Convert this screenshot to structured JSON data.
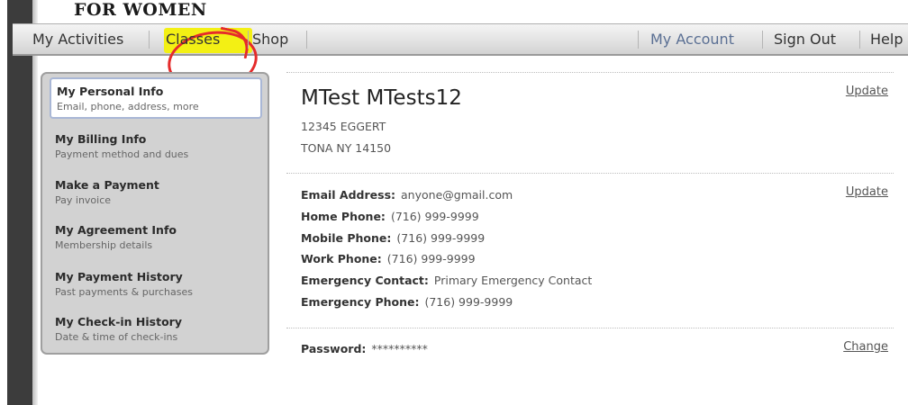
{
  "brand": "FOR WOMEN",
  "nav": {
    "left": [
      "My Activities",
      "Classes",
      "Shop"
    ],
    "right": [
      "My Account",
      "Sign Out",
      "Help"
    ]
  },
  "sidebar": {
    "items": [
      {
        "title": "My Personal Info",
        "subtitle": "Email, phone, address, more"
      },
      {
        "title": "My Billing Info",
        "subtitle": "Payment method and dues"
      },
      {
        "title": "Make a Payment",
        "subtitle": "Pay invoice"
      },
      {
        "title": "My Agreement Info",
        "subtitle": "Membership details"
      },
      {
        "title": "My Payment History",
        "subtitle": "Past payments & purchases"
      },
      {
        "title": "My Check-in History",
        "subtitle": "Date & time of check-ins"
      }
    ]
  },
  "profile": {
    "name": "MTest MTests12",
    "address_line1": "12345 EGGERT",
    "address_line2": "TONA NY 14150",
    "update_label": "Update"
  },
  "contact": {
    "update_label": "Update",
    "email_label": "Email Address:",
    "email": "anyone@gmail.com",
    "home_label": "Home Phone:",
    "home": "(716) 999-9999",
    "mobile_label": "Mobile Phone:",
    "mobile": "(716) 999-9999",
    "work_label": "Work Phone:",
    "work": "(716) 999-9999",
    "emergency_contact_label": "Emergency Contact:",
    "emergency_contact": "Primary Emergency Contact",
    "emergency_phone_label": "Emergency Phone:",
    "emergency_phone": "(716) 999-9999"
  },
  "password": {
    "label": "Password:",
    "value": "**********",
    "change_label": "Change"
  },
  "colors": {
    "highlight": "#f3f014",
    "annotation": "#e52b2b",
    "nav_right_text": "#5a6f93"
  }
}
